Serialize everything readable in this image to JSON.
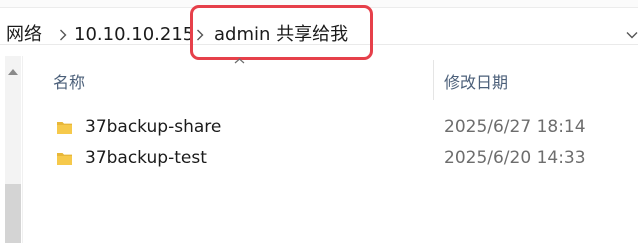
{
  "address_bar": {
    "breadcrumbs": [
      "网络",
      "10.10.10.215",
      "admin 共享给我"
    ]
  },
  "columns": {
    "name_label": "名称",
    "date_label": "修改日期"
  },
  "files": [
    {
      "name": "37backup-share",
      "modified": "2025/6/27 18:14",
      "icon": "folder-icon"
    },
    {
      "name": "37backup-test",
      "modified": "2025/6/20 14:33",
      "icon": "folder-icon"
    }
  ],
  "colors": {
    "highlight": "#e6404a",
    "folder": "#f6c94b",
    "header_text": "#4c607a"
  }
}
